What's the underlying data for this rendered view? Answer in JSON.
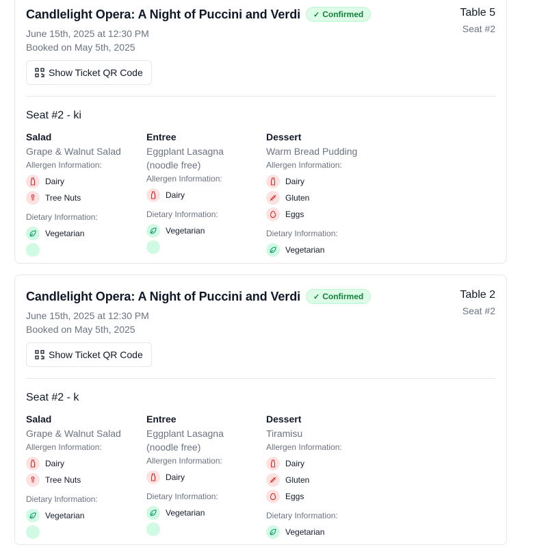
{
  "bookings": [
    {
      "title": "Candlelight Opera: A Night of Puccini and Verdi",
      "status": "Confirmed",
      "table": "Table 5",
      "seat": "Seat #2",
      "date": "June 15th, 2025 at 12:30 PM",
      "booked": "Booked on May 5th, 2025",
      "qr_button": "Show Ticket QR Code",
      "seat_title": "Seat #2 - ki",
      "courses": [
        {
          "course": "Salad",
          "dish_line1": "Grape & Walnut Salad",
          "dish_line2": "",
          "allergen_label": "Allergen Information:",
          "allergens": [
            "Dairy",
            "Tree Nuts"
          ],
          "dietary_label": "Dietary Information:",
          "dietary": [
            "Vegetarian"
          ]
        },
        {
          "course": "Entree",
          "dish_line1": "Eggplant Lasagna",
          "dish_line2": "(noodle free)",
          "allergen_label": "Allergen Information:",
          "allergens": [
            "Dairy"
          ],
          "dietary_label": "Dietary Information:",
          "dietary": [
            "Vegetarian"
          ]
        },
        {
          "course": "Dessert",
          "dish_line1": "Warm Bread Pudding",
          "dish_line2": "",
          "allergen_label": "Allergen Information:",
          "allergens": [
            "Dairy",
            "Gluten",
            "Eggs"
          ],
          "dietary_label": "Dietary Information:",
          "dietary": [
            "Vegetarian"
          ]
        }
      ]
    },
    {
      "title": "Candlelight Opera: A Night of Puccini and Verdi",
      "status": "Confirmed",
      "table": "Table 2",
      "seat": "Seat #2",
      "date": "June 15th, 2025 at 12:30 PM",
      "booked": "Booked on May 5th, 2025",
      "qr_button": "Show Ticket QR Code",
      "seat_title": "Seat #2 - k",
      "courses": [
        {
          "course": "Salad",
          "dish_line1": "Grape & Walnut Salad",
          "dish_line2": "",
          "allergen_label": "Allergen Information:",
          "allergens": [
            "Dairy",
            "Tree Nuts"
          ],
          "dietary_label": "Dietary Information:",
          "dietary": [
            "Vegetarian"
          ]
        },
        {
          "course": "Entree",
          "dish_line1": "Eggplant Lasagna",
          "dish_line2": "(noodle free)",
          "allergen_label": "Allergen Information:",
          "allergens": [
            "Dairy"
          ],
          "dietary_label": "Dietary Information:",
          "dietary": [
            "Vegetarian"
          ]
        },
        {
          "course": "Dessert",
          "dish_line1": "Tiramisu",
          "dish_line2": "",
          "allergen_label": "Allergen Information:",
          "allergens": [
            "Dairy",
            "Gluten",
            "Eggs"
          ],
          "dietary_label": "Dietary Information:",
          "dietary": [
            "Vegetarian"
          ]
        }
      ]
    }
  ],
  "icons": {
    "check": "check-icon",
    "qr": "qr-code-icon",
    "dairy": "milk-bottle-icon",
    "tree_nuts": "nut-icon",
    "gluten": "wheat-icon",
    "eggs": "egg-icon",
    "vegetarian": "leaf-icon"
  },
  "colors": {
    "badge_bg": "#dcfce7",
    "badge_text": "#15803d",
    "allergen_bg": "#fde2e2",
    "allergen_icon": "#dc2626",
    "diet_bg": "#d1fae5",
    "diet_icon": "#059669"
  }
}
